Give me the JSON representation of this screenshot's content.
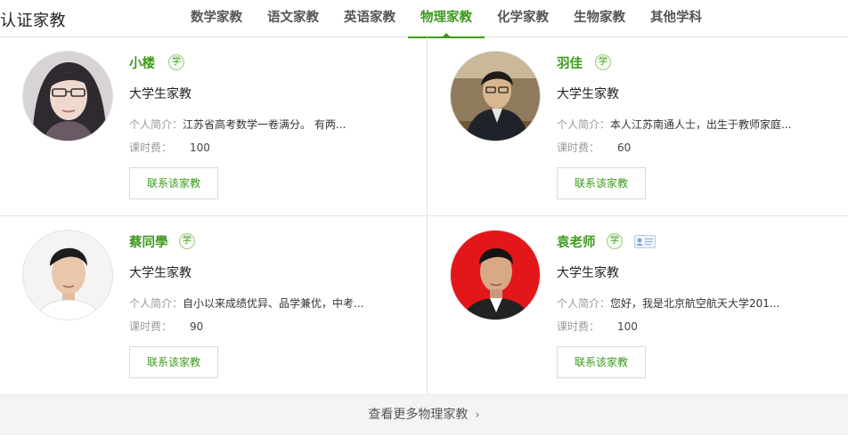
{
  "header": {
    "title": "认证家教",
    "tabs": [
      {
        "label": "数学家教",
        "active": false
      },
      {
        "label": "语文家教",
        "active": false
      },
      {
        "label": "英语家教",
        "active": false
      },
      {
        "label": "物理家教",
        "active": true
      },
      {
        "label": "化学家教",
        "active": false
      },
      {
        "label": "生物家教",
        "active": false
      },
      {
        "label": "其他学科",
        "active": false
      }
    ]
  },
  "tutors": [
    {
      "name": "小楼",
      "badge": "学",
      "level": "大学生家教",
      "intro_label": "个人简介：",
      "intro": "江苏省高考数学一卷满分。 有两...",
      "fee_label": "课时费：",
      "fee": "100",
      "contact_label": "联系该家教"
    },
    {
      "name": "羽佳",
      "badge": "学",
      "level": "大学生家教",
      "intro_label": "个人简介：",
      "intro": "本人江苏南通人士，出生于教师家庭...",
      "fee_label": "课时费：",
      "fee": "60",
      "contact_label": "联系该家教"
    },
    {
      "name": "蔡同學",
      "badge": "学",
      "level": "大学生家教",
      "intro_label": "个人简介：",
      "intro": "自小以来成绩优异、品学兼优，中考...",
      "fee_label": "课时费：",
      "fee": "90",
      "contact_label": "联系该家教"
    },
    {
      "name": "袁老师",
      "badge": "学",
      "level": "大学生家教",
      "intro_label": "个人简介：",
      "intro": "您好，我是北京航空航天大学201...",
      "fee_label": "课时费：",
      "fee": "100",
      "contact_label": "联系该家教",
      "id_verified_icon": "id-card-icon"
    }
  ],
  "more": {
    "label": "查看更多物理家教",
    "icon": "chevron-right-icon"
  },
  "colors": {
    "accent": "#3c9a1c",
    "divider": "#e3e3e3",
    "more_bg": "#f4f4f4"
  }
}
